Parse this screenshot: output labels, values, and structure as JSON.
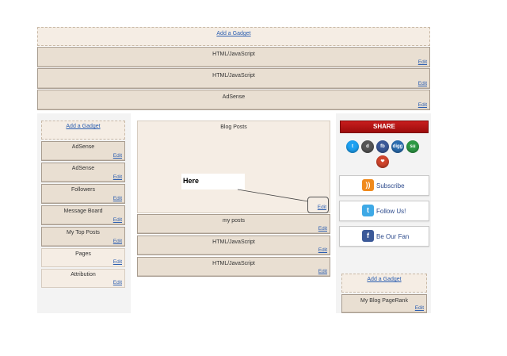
{
  "top": {
    "add_gadget": "Add a Gadget",
    "gadgets": [
      {
        "title": "HTML/JavaScript",
        "edit": "Edit"
      },
      {
        "title": "HTML/JavaScript",
        "edit": "Edit"
      },
      {
        "title": "AdSense",
        "edit": "Edit"
      }
    ]
  },
  "left_sidebar": {
    "add_gadget": "Add a Gadget",
    "gadgets": [
      {
        "title": "AdSense",
        "edit": "Edit"
      },
      {
        "title": "AdSense",
        "edit": "Edit"
      },
      {
        "title": "Followers",
        "edit": "Edit"
      },
      {
        "title": "Message Board",
        "edit": "Edit"
      },
      {
        "title": "My Top Posts",
        "edit": "Edit"
      },
      {
        "title": "Pages",
        "edit": "Edit"
      },
      {
        "title": "Attribution",
        "edit": "Edit"
      }
    ]
  },
  "main": {
    "blog_posts_title": "Blog Posts",
    "blog_posts_edit": "Edit",
    "annotation": "Here",
    "gadgets": [
      {
        "title": "my posts",
        "edit": "Edit"
      },
      {
        "title": "HTML/JavaScript",
        "edit": "Edit"
      },
      {
        "title": "HTML/JavaScript",
        "edit": "Edit"
      }
    ]
  },
  "right_sidebar": {
    "share_label": "SHARE",
    "social_icons": [
      {
        "name": "twitter-icon",
        "glyph": "t",
        "color": "#1da1f2"
      },
      {
        "name": "delicious-icon",
        "glyph": "d",
        "color": "#555555"
      },
      {
        "name": "facebook-icon",
        "glyph": "fb",
        "color": "#3b5998"
      },
      {
        "name": "digg-icon",
        "glyph": "digg",
        "color": "#2a6db0"
      },
      {
        "name": "stumbleupon-icon",
        "glyph": "su",
        "color": "#2e9a45"
      },
      {
        "name": "favorite-icon",
        "glyph": "❤",
        "color": "#d0442c"
      }
    ],
    "follow_buttons": [
      {
        "label": "Subscribe",
        "icon": "rss-icon",
        "glyph": "))",
        "color": "#f08a1c"
      },
      {
        "label": "Follow Us!",
        "icon": "twitter-icon",
        "glyph": "t",
        "color": "#3ea9e6"
      },
      {
        "label": "Be Our Fan",
        "icon": "facebook-icon",
        "glyph": "f",
        "color": "#3b5998"
      }
    ],
    "add_gadget": "Add a Gadget",
    "pagerank": {
      "title": "My Blog PageRank",
      "edit": "Edit"
    }
  }
}
